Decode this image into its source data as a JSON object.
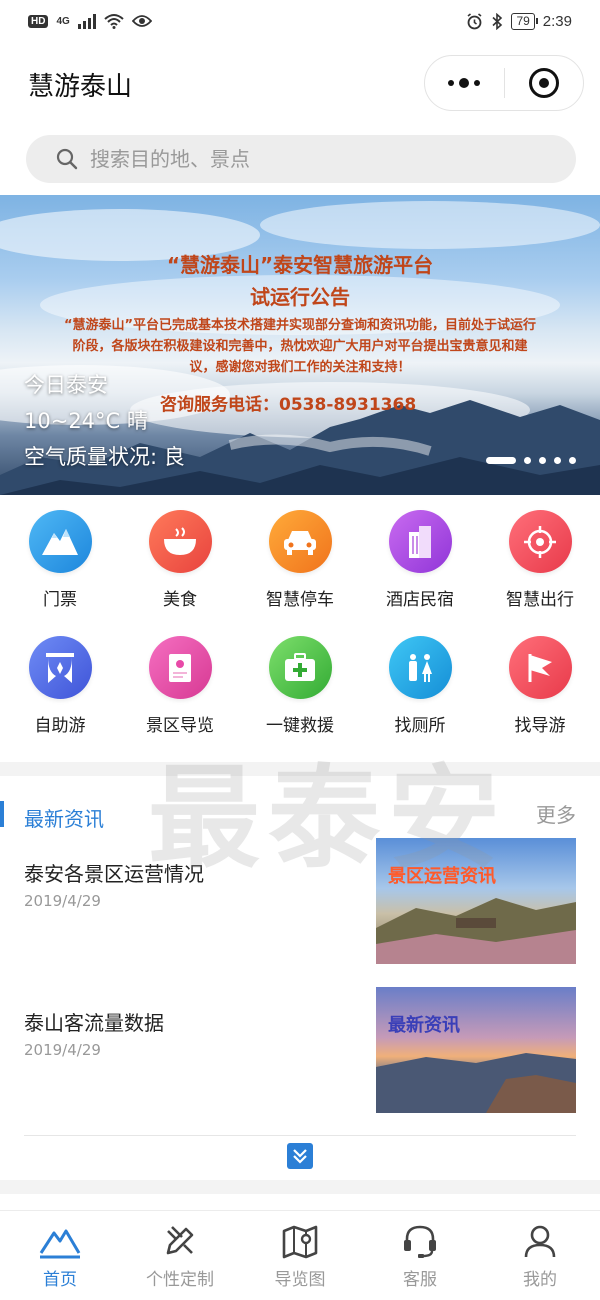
{
  "statusbar": {
    "hd": "HD",
    "network": "4G",
    "battery": "79",
    "time": "2:39"
  },
  "navbar": {
    "title": "慧游泰山"
  },
  "search": {
    "placeholder": "搜索目的地、景点"
  },
  "banner": {
    "notice_title": "“慧游泰山”泰安智慧旅游平台",
    "notice_subtitle": "试运行公告",
    "notice_body": "“慧游泰山”平台已完成基本技术搭建并实现部分查询和资讯功能，目前处于试运行阶段，各版块在积极建设和完善中，热忱欢迎广大用户对平台提出宝贵意见和建议，感谢您对我们工作的关注和支持！",
    "notice_phone": "咨询服务电话：0538-8931368",
    "weather_city": "今日泰安",
    "weather_temp": "10~24°C 晴",
    "weather_air": "空气质量状况: 良",
    "slide_count": 5,
    "active_slide": 1
  },
  "grid": {
    "row1": [
      {
        "label": "门票",
        "icon": "mountain-icon",
        "color": "#2f9be8"
      },
      {
        "label": "美食",
        "icon": "bowl-icon",
        "color": "#f0584a"
      },
      {
        "label": "智慧停车",
        "icon": "car-icon",
        "color": "#f58a25"
      },
      {
        "label": "酒店民宿",
        "icon": "building-icon",
        "color": "#b04ae2"
      },
      {
        "label": "智慧出行",
        "icon": "location-target-icon",
        "color": "#f04a5c"
      }
    ],
    "row2": [
      {
        "label": "自助游",
        "icon": "curtain-icon",
        "color": "#4f6ee8"
      },
      {
        "label": "景区导览",
        "icon": "map-guide-icon",
        "color": "#e84aa8"
      },
      {
        "label": "一键救援",
        "icon": "first-aid-icon",
        "color": "#4cc24a"
      },
      {
        "label": "找厕所",
        "icon": "restroom-icon",
        "color": "#1ea8e6"
      },
      {
        "label": "找导游",
        "icon": "flag-icon",
        "color": "#f04a5c"
      }
    ]
  },
  "news": {
    "title": "最新资讯",
    "more": "更多",
    "watermark": "最泰安",
    "items": [
      {
        "title": "泰安各景区运营情况",
        "date": "2019/4/29",
        "thumb_label": "景区运营资讯"
      },
      {
        "title": "泰山客流量数据",
        "date": "2019/4/29",
        "thumb_label": "最新资讯"
      }
    ]
  },
  "tabbar": [
    {
      "label": "首页",
      "icon": "home-mountain-icon",
      "active": true
    },
    {
      "label": "个性定制",
      "icon": "pencil-ruler-icon",
      "active": false
    },
    {
      "label": "导览图",
      "icon": "map-pin-icon",
      "active": false
    },
    {
      "label": "客服",
      "icon": "headset-icon",
      "active": false
    },
    {
      "label": "我的",
      "icon": "user-icon",
      "active": false
    }
  ],
  "colors": {
    "accent": "#2b7fd6",
    "notice_text": "#c0461a"
  }
}
